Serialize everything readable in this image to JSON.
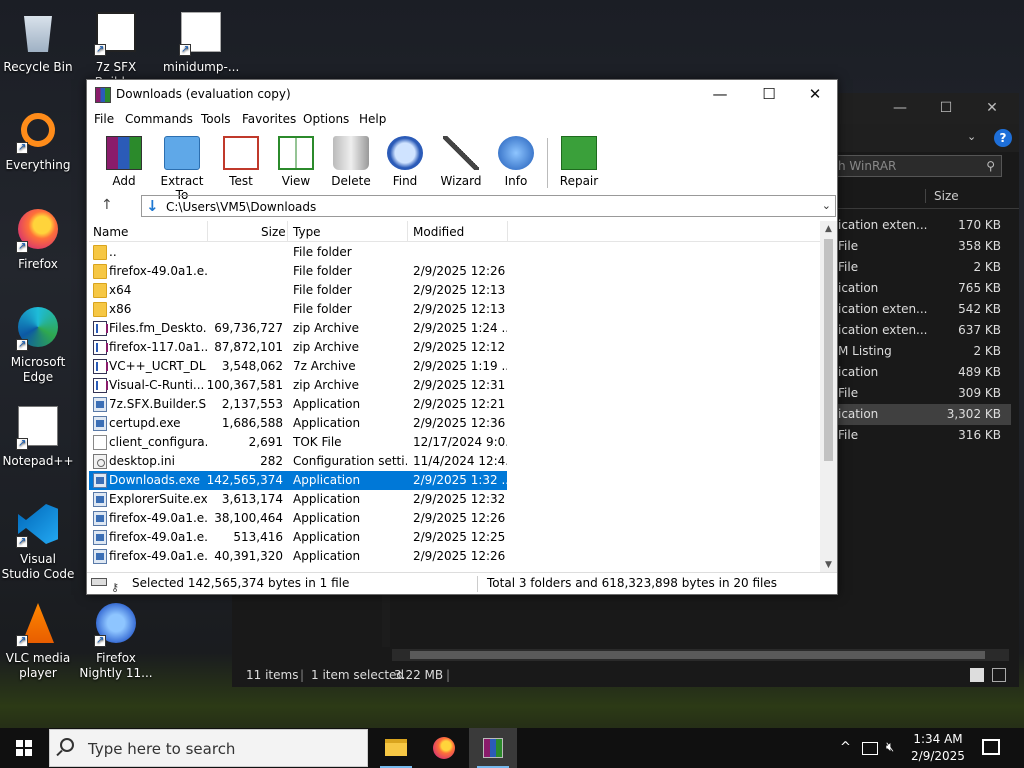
{
  "desktop": {
    "icons": [
      {
        "label": "Recycle Bin",
        "icon": "recycle-bin-icon"
      },
      {
        "label": "7z SFX Builder",
        "icon": "sfx-builder-icon"
      },
      {
        "label": "minidump-...",
        "icon": "minidump-icon"
      },
      {
        "label": "Everything",
        "icon": "everything-icon"
      },
      {
        "label": "Firefox",
        "icon": "firefox-icon"
      },
      {
        "label": "Microsoft Edge",
        "icon": "edge-icon"
      },
      {
        "label": "Notepad++",
        "icon": "notepadpp-icon"
      },
      {
        "label": "Visual Studio Code",
        "icon": "vscode-icon"
      },
      {
        "label": "VLC media player",
        "icon": "vlc-icon"
      },
      {
        "label": "Firefox Nightly 11...",
        "icon": "firefox-nightly-icon"
      }
    ]
  },
  "explorer_bg": {
    "search_placeholder": "h WinRAR",
    "column_size": "Size",
    "rows": [
      {
        "name": "ication exten...",
        "size": "170 KB"
      },
      {
        "name": "File",
        "size": "358 KB"
      },
      {
        "name": "File",
        "size": "2 KB"
      },
      {
        "name": "ication",
        "size": "765 KB"
      },
      {
        "name": "ication exten...",
        "size": "542 KB"
      },
      {
        "name": "ication exten...",
        "size": "637 KB"
      },
      {
        "name": "M Listing",
        "size": "2 KB"
      },
      {
        "name": "ication",
        "size": "489 KB"
      },
      {
        "name": "File",
        "size": "309 KB"
      },
      {
        "name": "ication",
        "size": "3,302 KB"
      },
      {
        "name": "File",
        "size": "316 KB"
      }
    ],
    "selected_row": 9,
    "status_items": "11 items",
    "status_selected": "1 item selected",
    "status_size": "3.22 MB"
  },
  "winrar": {
    "title": "Downloads (evaluation copy)",
    "menu": [
      "File",
      "Commands",
      "Tools",
      "Favorites",
      "Options",
      "Help"
    ],
    "toolbar": [
      {
        "label": "Add",
        "icon": "add-icon"
      },
      {
        "label": "Extract To",
        "icon": "extract-icon"
      },
      {
        "label": "Test",
        "icon": "test-icon"
      },
      {
        "label": "View",
        "icon": "view-icon"
      },
      {
        "label": "Delete",
        "icon": "delete-icon"
      },
      {
        "label": "Find",
        "icon": "find-icon"
      },
      {
        "label": "Wizard",
        "icon": "wizard-icon"
      },
      {
        "label": "Info",
        "icon": "info-icon"
      },
      {
        "label": "Repair",
        "icon": "repair-icon"
      }
    ],
    "path": "C:\\Users\\VM5\\Downloads",
    "columns": {
      "name": "Name",
      "size": "Size",
      "type": "Type",
      "modified": "Modified"
    },
    "files": [
      {
        "name": "..",
        "size": "",
        "type": "File folder",
        "modified": "",
        "kind": "folder"
      },
      {
        "name": "firefox-49.0a1.e...",
        "size": "",
        "type": "File folder",
        "modified": "2/9/2025 12:26 ...",
        "kind": "folder"
      },
      {
        "name": "x64",
        "size": "",
        "type": "File folder",
        "modified": "2/9/2025 12:13 ...",
        "kind": "folder"
      },
      {
        "name": "x86",
        "size": "",
        "type": "File folder",
        "modified": "2/9/2025 12:13 ...",
        "kind": "folder"
      },
      {
        "name": "Files.fm_Deskto...",
        "size": "69,736,727",
        "type": "zip Archive",
        "modified": "2/9/2025 1:24 ...",
        "kind": "zip"
      },
      {
        "name": "firefox-117.0a1...",
        "size": "87,872,101",
        "type": "zip Archive",
        "modified": "2/9/2025 12:12 ...",
        "kind": "zip"
      },
      {
        "name": "VC++_UCRT_DL...",
        "size": "3,548,062",
        "type": "7z Archive",
        "modified": "2/9/2025 1:19 ...",
        "kind": "zip"
      },
      {
        "name": "Visual-C-Runti...",
        "size": "100,367,581",
        "type": "zip Archive",
        "modified": "2/9/2025 12:31 ...",
        "kind": "zip"
      },
      {
        "name": "7z.SFX.Builder.S...",
        "size": "2,137,553",
        "type": "Application",
        "modified": "2/9/2025 12:21 ...",
        "kind": "app"
      },
      {
        "name": "certupd.exe",
        "size": "1,686,588",
        "type": "Application",
        "modified": "2/9/2025 12:36 ...",
        "kind": "app"
      },
      {
        "name": "client_configura...",
        "size": "2,691",
        "type": "TOK File",
        "modified": "12/17/2024 9:0...",
        "kind": "file"
      },
      {
        "name": "desktop.ini",
        "size": "282",
        "type": "Configuration setti...",
        "modified": "11/4/2024 12:4...",
        "kind": "cfg"
      },
      {
        "name": "Downloads.exe",
        "size": "142,565,374",
        "type": "Application",
        "modified": "2/9/2025 1:32 ...",
        "kind": "app"
      },
      {
        "name": "ExplorerSuite.exe",
        "size": "3,613,174",
        "type": "Application",
        "modified": "2/9/2025 12:32 ...",
        "kind": "app"
      },
      {
        "name": "firefox-49.0a1.e...",
        "size": "38,100,464",
        "type": "Application",
        "modified": "2/9/2025 12:26 ...",
        "kind": "app"
      },
      {
        "name": "firefox-49.0a1.e...",
        "size": "513,416",
        "type": "Application",
        "modified": "2/9/2025 12:25 ...",
        "kind": "app"
      },
      {
        "name": "firefox-49.0a1.e...",
        "size": "40,391,320",
        "type": "Application",
        "modified": "2/9/2025 12:26 ...",
        "kind": "app"
      }
    ],
    "selected_index": 12,
    "status_left": "Selected 142,565,374 bytes in 1 file",
    "status_right": "Total 3 folders and 618,323,898 bytes in 20 files"
  },
  "taskbar": {
    "search_placeholder": "Type here to search",
    "apps": [
      "file-explorer-icon",
      "firefox-icon",
      "winrar-icon"
    ],
    "time": "1:34 AM",
    "date": "2/9/2025"
  },
  "colors": {
    "selection": "#0078d7",
    "taskbar": "#101010"
  }
}
